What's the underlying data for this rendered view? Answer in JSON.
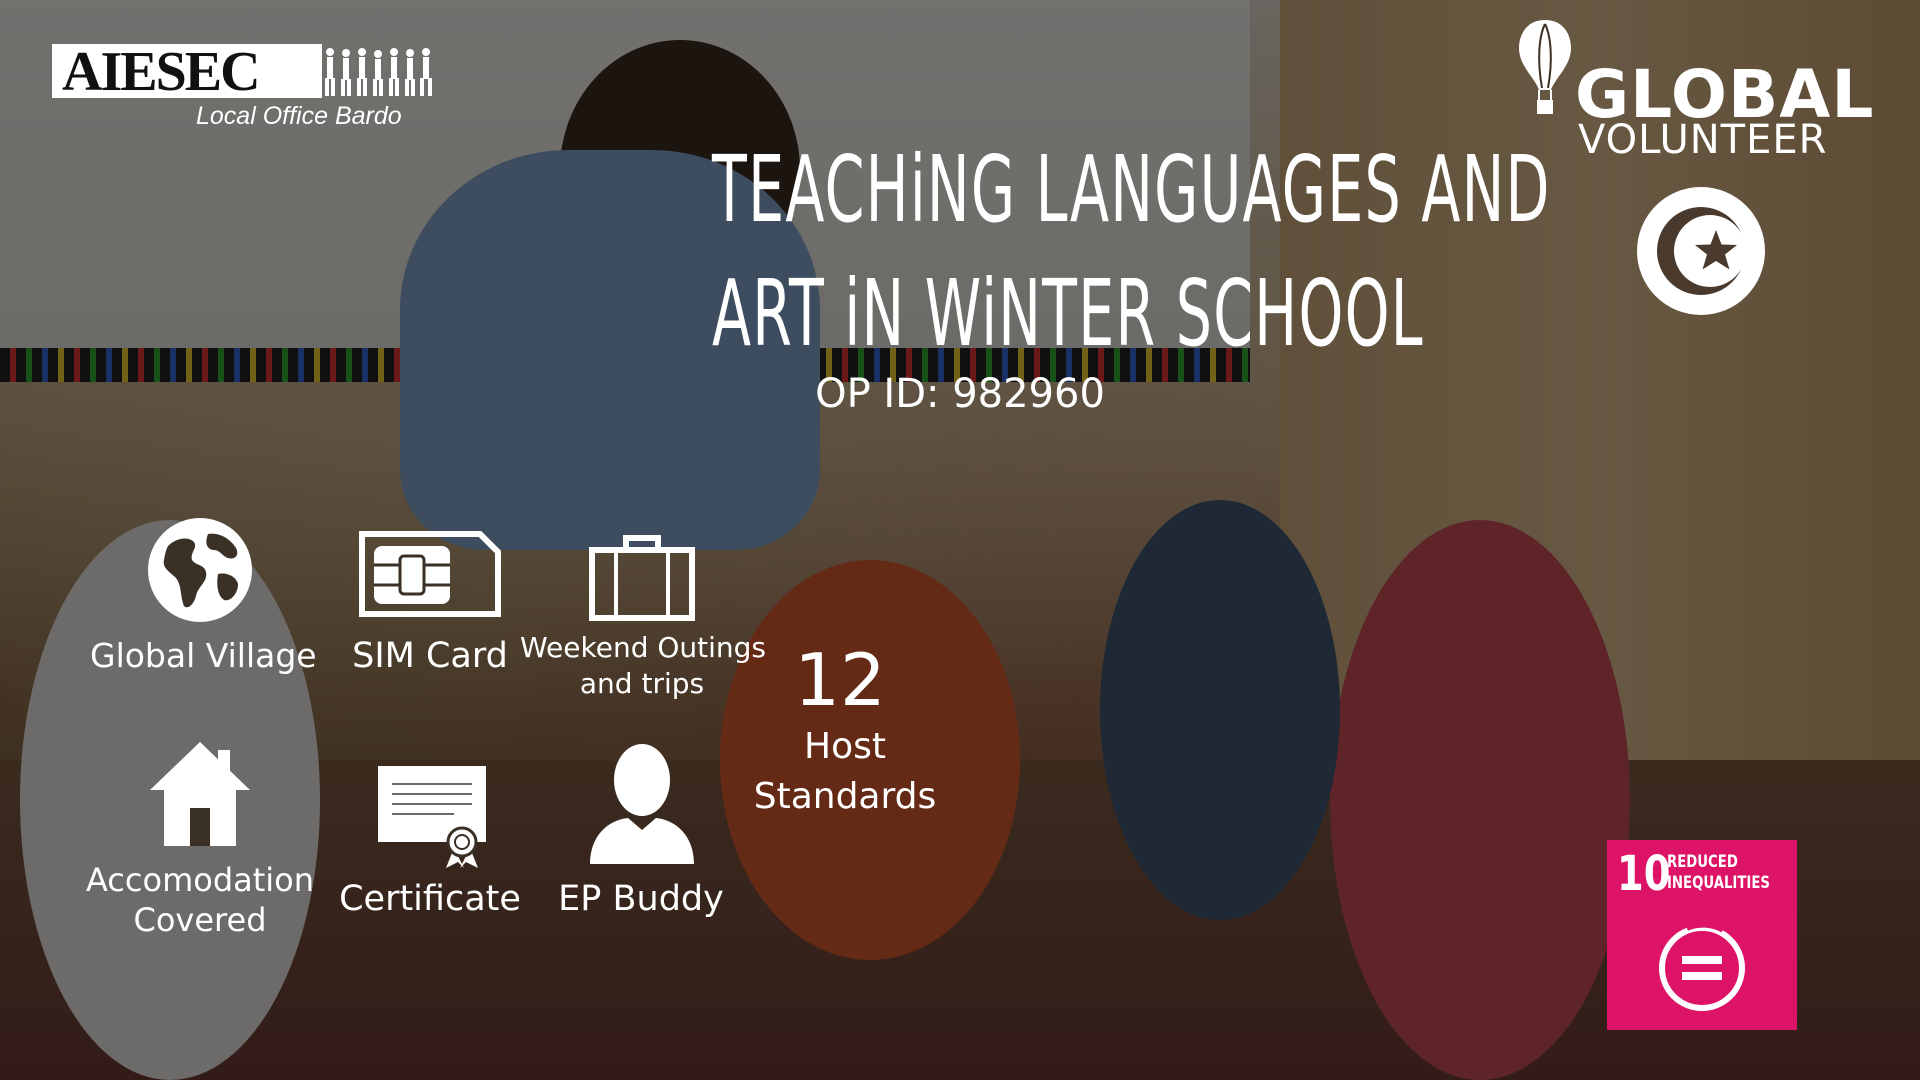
{
  "brand": {
    "name": "AIESEC",
    "office": "Local Office Bardo"
  },
  "program": {
    "line1": "GLOBAL",
    "line2": "VOLUNTEER"
  },
  "title": {
    "line1": "TEACHiNG LANGUAGES AND",
    "line2": "ART iN WiNTER SCHOOL"
  },
  "op_id": "OP ID: 982960",
  "features": [
    {
      "label": "Global Village",
      "icon": "globe-icon"
    },
    {
      "label": "SIM Card",
      "icon": "sim-card-icon"
    },
    {
      "label_line1": "Weekend Outings",
      "label_line2": "and trips",
      "icon": "suitcase-icon"
    },
    {
      "label_line1": "Accomodation",
      "label_line2": "Covered",
      "icon": "house-icon"
    },
    {
      "label": "Certificate",
      "icon": "certificate-icon"
    },
    {
      "label": "EP Buddy",
      "icon": "person-icon"
    }
  ],
  "host_standards": {
    "count": "12",
    "line1": "Host",
    "line2": "Standards"
  },
  "sdg": {
    "number": "10",
    "line1": "REDUCED",
    "line2": "INEQUALITIES",
    "color": "#dd1367"
  },
  "colors": {
    "text": "#ffffff",
    "overlay": "rgba(0,0,0,0.52)"
  }
}
